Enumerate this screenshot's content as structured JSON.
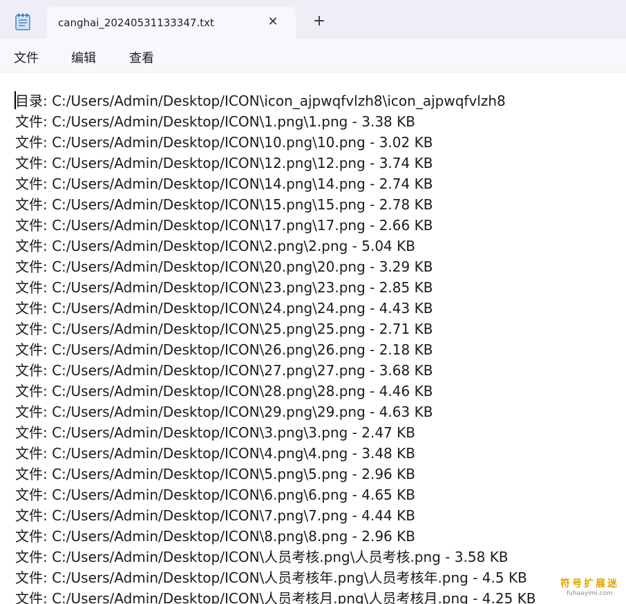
{
  "tab": {
    "title": "canghai_20240531133347.txt",
    "close_symbol": "✕",
    "new_tab_symbol": "+"
  },
  "menu": {
    "file": "文件",
    "edit": "编辑",
    "view": "查看"
  },
  "icons": {
    "app": "notepad-icon",
    "close": "close-icon",
    "new_tab": "plus-icon"
  },
  "colors": {
    "tabbar_bg": "#eeeff6",
    "tab_active_bg": "#f7f8fc",
    "text": "#1a1a1a",
    "watermark": "#e0a100"
  },
  "content": {
    "lines": [
      "目录: C:/Users/Admin/Desktop/ICON\\icon_ajpwqfvlzh8\\icon_ajpwqfvlzh8",
      "文件: C:/Users/Admin/Desktop/ICON\\1.png\\1.png - 3.38 KB",
      "文件: C:/Users/Admin/Desktop/ICON\\10.png\\10.png - 3.02 KB",
      "文件: C:/Users/Admin/Desktop/ICON\\12.png\\12.png - 3.74 KB",
      "文件: C:/Users/Admin/Desktop/ICON\\14.png\\14.png - 2.74 KB",
      "文件: C:/Users/Admin/Desktop/ICON\\15.png\\15.png - 2.78 KB",
      "文件: C:/Users/Admin/Desktop/ICON\\17.png\\17.png - 2.66 KB",
      "文件: C:/Users/Admin/Desktop/ICON\\2.png\\2.png - 5.04 KB",
      "文件: C:/Users/Admin/Desktop/ICON\\20.png\\20.png - 3.29 KB",
      "文件: C:/Users/Admin/Desktop/ICON\\23.png\\23.png - 2.85 KB",
      "文件: C:/Users/Admin/Desktop/ICON\\24.png\\24.png - 4.43 KB",
      "文件: C:/Users/Admin/Desktop/ICON\\25.png\\25.png - 2.71 KB",
      "文件: C:/Users/Admin/Desktop/ICON\\26.png\\26.png - 2.18 KB",
      "文件: C:/Users/Admin/Desktop/ICON\\27.png\\27.png - 3.68 KB",
      "文件: C:/Users/Admin/Desktop/ICON\\28.png\\28.png - 4.46 KB",
      "文件: C:/Users/Admin/Desktop/ICON\\29.png\\29.png - 4.63 KB",
      "文件: C:/Users/Admin/Desktop/ICON\\3.png\\3.png - 2.47 KB",
      "文件: C:/Users/Admin/Desktop/ICON\\4.png\\4.png - 3.48 KB",
      "文件: C:/Users/Admin/Desktop/ICON\\5.png\\5.png - 2.96 KB",
      "文件: C:/Users/Admin/Desktop/ICON\\6.png\\6.png - 4.65 KB",
      "文件: C:/Users/Admin/Desktop/ICON\\7.png\\7.png - 4.44 KB",
      "文件: C:/Users/Admin/Desktop/ICON\\8.png\\8.png - 2.96 KB",
      "文件: C:/Users/Admin/Desktop/ICON\\人员考核.png\\人员考核.png - 3.58 KB",
      "文件: C:/Users/Admin/Desktop/ICON\\人员考核年.png\\人员考核年.png - 4.5 KB",
      "文件: C:/Users/Admin/Desktop/ICON\\人员考核月.png\\人员考核月.png - 4.25 KB"
    ]
  },
  "watermark": {
    "main": "符号扩展迷",
    "sub": "fuhaoyimi.com"
  }
}
